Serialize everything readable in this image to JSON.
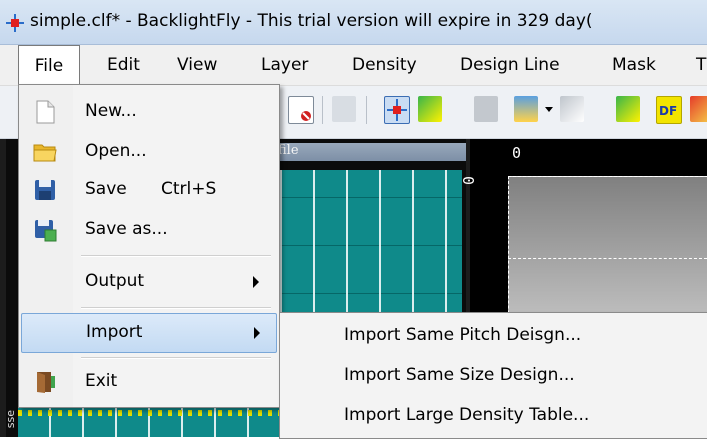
{
  "window": {
    "title": "simple.clf* - BacklightFly - This trial version will expire in 329 day("
  },
  "menubar": {
    "items": [
      "File",
      "Edit",
      "View",
      "Layer",
      "Density",
      "Design Line",
      "Mask",
      "T"
    ]
  },
  "panes": {
    "left_header": "file",
    "side_label": "sse",
    "coord_x": "0",
    "coord_y": "0"
  },
  "file_menu": {
    "items": [
      {
        "label": "New...",
        "icon": "new-file-icon"
      },
      {
        "label": "Open...",
        "icon": "folder-open-icon"
      },
      {
        "label": "Save",
        "shortcut": "Ctrl+S",
        "icon": "floppy-disk-icon"
      },
      {
        "label": "Save as...",
        "icon": "save-as-icon"
      },
      {
        "label": "Output",
        "has_submenu": true
      },
      {
        "label": "Import",
        "has_submenu": true,
        "highlighted": true
      },
      {
        "label": "Exit",
        "icon": "exit-door-icon"
      }
    ]
  },
  "import_submenu": {
    "items": [
      "Import Same Pitch Deisgn...",
      "Import Same Size Design...",
      "Import Large Density Table..."
    ]
  },
  "colors": {
    "grid_teal": "#0f8a8a",
    "highlight": "#c3daf3",
    "titlebar": "#c6d8ee"
  }
}
